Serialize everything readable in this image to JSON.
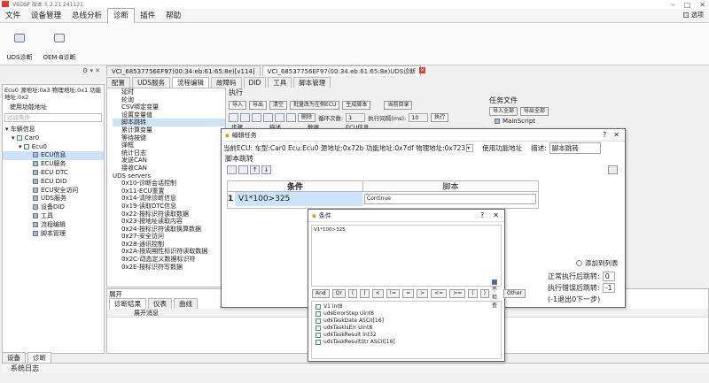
{
  "window_title": "VBDSF 版本:5.2.21.241121",
  "menu": [
    "文件",
    "设备管理",
    "总线分析",
    "诊断",
    "插件",
    "帮助"
  ],
  "menu_right": "选项",
  "ribbon": [
    {
      "label": "UDS诊断"
    },
    {
      "label": "OEM-B诊断"
    }
  ],
  "left": {
    "ecu_info": "Ecu0 源地址:0x3 物理地址:0x1 功能地址:0x2",
    "use_func_addr": "使用功能地址",
    "filter_placeholder": "过滤条件",
    "tree": [
      "车辆信息",
      "Car0",
      "Ecu0",
      "ECU信息",
      "ECU服务",
      "ECU DTC",
      "ECU DID",
      "ECU安全访问",
      "UDS服务",
      "设备DID",
      "工具",
      "流程编辑",
      "脚本管理"
    ],
    "bottom_tabs": [
      "设备",
      "诊断"
    ]
  },
  "doc_tabs": [
    "VCI_68537756EF97(00:34:eb:61:65:8e)[v114]",
    "VCI_68537756EF97(00:34:eb:61:65:8e)UDS诊断"
  ],
  "sub_tabs": [
    "配置",
    "UDS服务",
    "流程编辑",
    "故障码",
    "DID",
    "工具",
    "脚本管理"
  ],
  "cmd_list": [
    "延时",
    "轮询",
    "CSV绑定变量",
    "设置变量值",
    "脚本跳转",
    "累计算变量",
    "等待按键",
    "弹框",
    "统计日志",
    "发送CAN",
    "接收CAN",
    "UDS servers",
    "0x10-诊断会话控制",
    "0x11-ECU重置",
    "0x14-清除诊断信息",
    "0x19-读取DTC信息",
    "0x22-按标识符读取数据",
    "0x23-按地址读取内容",
    "0x24-按标识符读取换算数据",
    "0x27-安全访问",
    "0x28-通讯控制",
    "0x2A-按周期性标识符读取数据",
    "0x2C-动态定义数据标识符",
    "0x2E-按标识符写数据"
  ],
  "exec": {
    "title": "执行",
    "btns": [
      "导入",
      "导出",
      "清空",
      "批量改为左侧ECU",
      "生成脚本",
      "当前目录"
    ],
    "delete": "删除",
    "loop_label": "循环次数:",
    "loop_value": "1",
    "interval_label": "执行间隔(ms):",
    "interval_value": "10",
    "run": "执行",
    "cols": [
      "步骤",
      "描述",
      "数据",
      "ECU信息"
    ]
  },
  "task": {
    "title": "任务文件",
    "import_all": "导入全部",
    "export_all": "导出全部",
    "item": "MainScript"
  },
  "dlg_edit": {
    "title": "编辑任务",
    "info": "当前ECU: 车型:Car0 Ecu:Ecu0 源地址:0x72b 功能地址:0x7df 物理地址:0x723",
    "use_func": "使用功能地址",
    "desc_label": "描述:",
    "desc_value": "脚本跳转",
    "section": "脚本跳转",
    "col_cond": "条件",
    "col_script": "脚本",
    "row_num": "1",
    "row_cond": "V1*100>325",
    "row_script": "Continue",
    "add_list": "添加到列表",
    "ok_label": "正常执行后跳转:",
    "ok_value": "0",
    "err_label": "执行错误后跳转:",
    "err_value": "-1",
    "hint": "(-1退出0下一步)"
  },
  "dlg_cond": {
    "title": "条件",
    "expr": "V1*100>325",
    "ops": [
      "And",
      "Or",
      "(",
      ")",
      "<",
      "!=",
      "=",
      ">",
      "<=",
      ">=",
      "(",
      ")"
    ],
    "check": "不检查",
    "other": "Other",
    "fields": [
      [
        "V1",
        "Int8"
      ],
      [
        "udsErrorStep",
        "Uint8"
      ],
      [
        "udsTaskDate",
        "ASCII[16]"
      ],
      [
        "udsTaskIsErr",
        "Uint8"
      ],
      [
        "udsTaskResult",
        "Int32"
      ],
      [
        "udsTaskResultStr",
        "ASCII[16]"
      ]
    ]
  },
  "bottom": {
    "expand": "展开",
    "tabs": [
      "诊断结果",
      "仪表",
      "曲线"
    ],
    "col": "展开消息",
    "status": "系统日志"
  }
}
